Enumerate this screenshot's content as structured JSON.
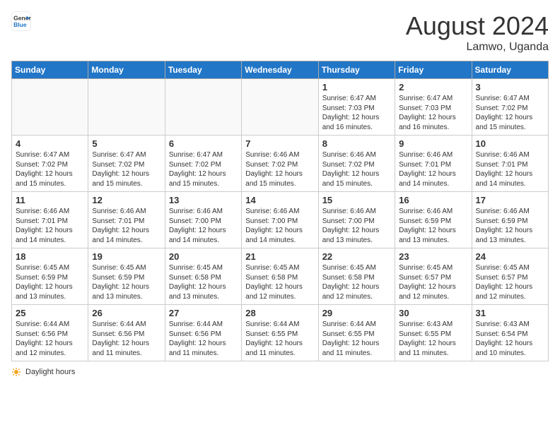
{
  "header": {
    "logo_line1": "General",
    "logo_line2": "Blue",
    "month_year": "August 2024",
    "location": "Lamwo, Uganda"
  },
  "days_of_week": [
    "Sunday",
    "Monday",
    "Tuesday",
    "Wednesday",
    "Thursday",
    "Friday",
    "Saturday"
  ],
  "footer_label": "Daylight hours",
  "weeks": [
    [
      {
        "day": "",
        "info": ""
      },
      {
        "day": "",
        "info": ""
      },
      {
        "day": "",
        "info": ""
      },
      {
        "day": "",
        "info": ""
      },
      {
        "day": "1",
        "info": "Sunrise: 6:47 AM\nSunset: 7:03 PM\nDaylight: 12 hours\nand 16 minutes."
      },
      {
        "day": "2",
        "info": "Sunrise: 6:47 AM\nSunset: 7:03 PM\nDaylight: 12 hours\nand 16 minutes."
      },
      {
        "day": "3",
        "info": "Sunrise: 6:47 AM\nSunset: 7:02 PM\nDaylight: 12 hours\nand 15 minutes."
      }
    ],
    [
      {
        "day": "4",
        "info": "Sunrise: 6:47 AM\nSunset: 7:02 PM\nDaylight: 12 hours\nand 15 minutes."
      },
      {
        "day": "5",
        "info": "Sunrise: 6:47 AM\nSunset: 7:02 PM\nDaylight: 12 hours\nand 15 minutes."
      },
      {
        "day": "6",
        "info": "Sunrise: 6:47 AM\nSunset: 7:02 PM\nDaylight: 12 hours\nand 15 minutes."
      },
      {
        "day": "7",
        "info": "Sunrise: 6:46 AM\nSunset: 7:02 PM\nDaylight: 12 hours\nand 15 minutes."
      },
      {
        "day": "8",
        "info": "Sunrise: 6:46 AM\nSunset: 7:02 PM\nDaylight: 12 hours\nand 15 minutes."
      },
      {
        "day": "9",
        "info": "Sunrise: 6:46 AM\nSunset: 7:01 PM\nDaylight: 12 hours\nand 14 minutes."
      },
      {
        "day": "10",
        "info": "Sunrise: 6:46 AM\nSunset: 7:01 PM\nDaylight: 12 hours\nand 14 minutes."
      }
    ],
    [
      {
        "day": "11",
        "info": "Sunrise: 6:46 AM\nSunset: 7:01 PM\nDaylight: 12 hours\nand 14 minutes."
      },
      {
        "day": "12",
        "info": "Sunrise: 6:46 AM\nSunset: 7:01 PM\nDaylight: 12 hours\nand 14 minutes."
      },
      {
        "day": "13",
        "info": "Sunrise: 6:46 AM\nSunset: 7:00 PM\nDaylight: 12 hours\nand 14 minutes."
      },
      {
        "day": "14",
        "info": "Sunrise: 6:46 AM\nSunset: 7:00 PM\nDaylight: 12 hours\nand 14 minutes."
      },
      {
        "day": "15",
        "info": "Sunrise: 6:46 AM\nSunset: 7:00 PM\nDaylight: 12 hours\nand 13 minutes."
      },
      {
        "day": "16",
        "info": "Sunrise: 6:46 AM\nSunset: 6:59 PM\nDaylight: 12 hours\nand 13 minutes."
      },
      {
        "day": "17",
        "info": "Sunrise: 6:46 AM\nSunset: 6:59 PM\nDaylight: 12 hours\nand 13 minutes."
      }
    ],
    [
      {
        "day": "18",
        "info": "Sunrise: 6:45 AM\nSunset: 6:59 PM\nDaylight: 12 hours\nand 13 minutes."
      },
      {
        "day": "19",
        "info": "Sunrise: 6:45 AM\nSunset: 6:59 PM\nDaylight: 12 hours\nand 13 minutes."
      },
      {
        "day": "20",
        "info": "Sunrise: 6:45 AM\nSunset: 6:58 PM\nDaylight: 12 hours\nand 13 minutes."
      },
      {
        "day": "21",
        "info": "Sunrise: 6:45 AM\nSunset: 6:58 PM\nDaylight: 12 hours\nand 12 minutes."
      },
      {
        "day": "22",
        "info": "Sunrise: 6:45 AM\nSunset: 6:58 PM\nDaylight: 12 hours\nand 12 minutes."
      },
      {
        "day": "23",
        "info": "Sunrise: 6:45 AM\nSunset: 6:57 PM\nDaylight: 12 hours\nand 12 minutes."
      },
      {
        "day": "24",
        "info": "Sunrise: 6:45 AM\nSunset: 6:57 PM\nDaylight: 12 hours\nand 12 minutes."
      }
    ],
    [
      {
        "day": "25",
        "info": "Sunrise: 6:44 AM\nSunset: 6:56 PM\nDaylight: 12 hours\nand 12 minutes."
      },
      {
        "day": "26",
        "info": "Sunrise: 6:44 AM\nSunset: 6:56 PM\nDaylight: 12 hours\nand 11 minutes."
      },
      {
        "day": "27",
        "info": "Sunrise: 6:44 AM\nSunset: 6:56 PM\nDaylight: 12 hours\nand 11 minutes."
      },
      {
        "day": "28",
        "info": "Sunrise: 6:44 AM\nSunset: 6:55 PM\nDaylight: 12 hours\nand 11 minutes."
      },
      {
        "day": "29",
        "info": "Sunrise: 6:44 AM\nSunset: 6:55 PM\nDaylight: 12 hours\nand 11 minutes."
      },
      {
        "day": "30",
        "info": "Sunrise: 6:43 AM\nSunset: 6:55 PM\nDaylight: 12 hours\nand 11 minutes."
      },
      {
        "day": "31",
        "info": "Sunrise: 6:43 AM\nSunset: 6:54 PM\nDaylight: 12 hours\nand 10 minutes."
      }
    ]
  ]
}
